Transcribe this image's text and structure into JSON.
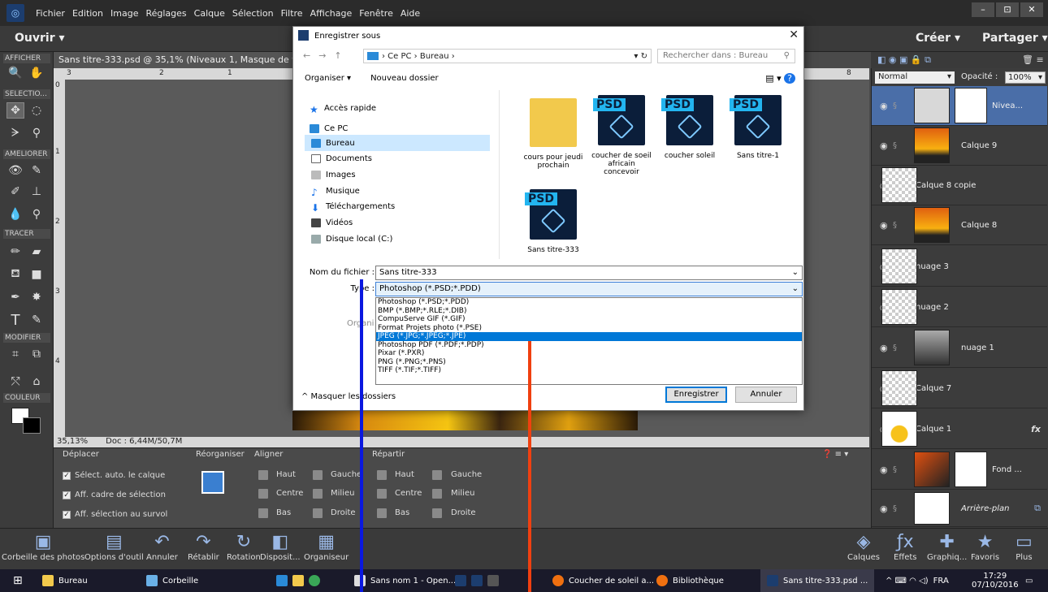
{
  "menu": {
    "items": [
      "Fichier",
      "Edition",
      "Image",
      "Réglages",
      "Calque",
      "Sélection",
      "Filtre",
      "Affichage",
      "Fenêtre",
      "Aide"
    ]
  },
  "window_controls": [
    "–",
    "⊡",
    "✕"
  ],
  "topbar": {
    "open": "Ouvrir ▾",
    "create": "Créer ▾",
    "share": "Partager ▾"
  },
  "tools": {
    "sections": [
      "AFFICHER",
      "SELECTIO...",
      "AMELIORER",
      "TRACER",
      "MODIFIER",
      "COULEUR"
    ]
  },
  "document": {
    "tab_title": "Sans titre-333.psd @ 35,1% (Niveaux 1, Masque de fusion/8) *",
    "ruler_top": [
      "3",
      "2",
      "1",
      "8"
    ],
    "ruler_left": [
      "0",
      "1",
      "2",
      "3",
      "4"
    ],
    "zoom": "35,13%",
    "doc_info": "Doc : 6,44M/50,7M"
  },
  "options": {
    "move_label": "Déplacer",
    "reorganize_label": "Réorganiser",
    "align_label": "Aligner",
    "distribute_label": "Répartir",
    "checks": [
      "Sélect. auto. le calque",
      "Aff. cadre de sélection",
      "Aff. sélection au survol"
    ],
    "align": {
      "haut": "Haut",
      "centre": "Centre",
      "bas": "Bas",
      "gauche": "Gauche",
      "milieu": "Milieu",
      "droite": "Droite"
    },
    "distribute": {
      "haut": "Haut",
      "centre": "Centre",
      "bas": "Bas",
      "gauche": "Gauche",
      "milieu": "Milieu",
      "droite": "Droite"
    }
  },
  "bottombar": {
    "left": [
      "Corbeille des photos",
      "Options d'outil",
      "Annuler",
      "Rétablir",
      "Rotation",
      "Disposit...",
      "Organiseur"
    ],
    "right": [
      "Calques",
      "Effets",
      "Graphiq...",
      "Favoris",
      "Plus"
    ]
  },
  "layers_panel": {
    "blend_mode": "Normal",
    "opacity_label": "Opacité :",
    "opacity_value": "100%",
    "layers": [
      {
        "name": "Nivea...",
        "active": true
      },
      {
        "name": "Calque 9"
      },
      {
        "name": "Calque 8 copie"
      },
      {
        "name": "Calque 8"
      },
      {
        "name": "nuage 3"
      },
      {
        "name": "nuage 2"
      },
      {
        "name": "nuage 1"
      },
      {
        "name": "Calque 7"
      },
      {
        "name": "Calque 1",
        "fx": "fx"
      },
      {
        "name": "Fond ..."
      },
      {
        "name": "Arrière-plan"
      }
    ]
  },
  "dialog": {
    "title": "Enregistrer sous",
    "address": "› Ce PC  ›  Bureau  ›",
    "search_placeholder": "Rechercher dans : Bureau",
    "organize": "Organiser ▾",
    "new_folder": "Nouveau dossier",
    "nav": [
      "Accès rapide",
      "Ce PC",
      "Bureau",
      "Documents",
      "Images",
      "Musique",
      "Téléchargements",
      "Vidéos",
      "Disque local (C:)"
    ],
    "files": [
      {
        "name": "cours pour jeudi prochain",
        "kind": "folder"
      },
      {
        "name": "coucher de soeil africain concevoir",
        "kind": "psd"
      },
      {
        "name": "coucher soleil",
        "kind": "psd"
      },
      {
        "name": "Sans titre-1",
        "kind": "psd"
      },
      {
        "name": "Sans titre-333",
        "kind": "psd"
      }
    ],
    "psd_tag": "PSD",
    "filename_label": "Nom du fichier :",
    "filename_value": "Sans titre-333",
    "type_label": "Type :",
    "type_value": "Photoshop (*.PSD;*.PDD)",
    "type_options": [
      "Photoshop (*.PSD;*.PDD)",
      "BMP (*.BMP;*.RLE;*.DIB)",
      "CompuServe GIF (*.GIF)",
      "Format Projets photo (*.PSE)",
      "JPEG (*.JPG;*.JPEG;*.JPE)",
      "Photoshop PDF (*.PDF;*.PDP)",
      "Pixar (*.PXR)",
      "PNG (*.PNG;*.PNS)",
      "TIFF (*.TIF;*.TIFF)"
    ],
    "type_highlighted_index": 4,
    "organize_partial": "Organi",
    "hide_folders": "^ Masquer les dossiers",
    "save": "Enregistrer",
    "cancel": "Annuler"
  },
  "taskbar": {
    "items": [
      "Bureau",
      "Corbeille",
      "Sans nom 1 - Open...",
      "Coucher de soleil a...",
      "Bibliothèque",
      "Sans titre-333.psd ..."
    ],
    "tray": "FRA",
    "time": "17:29",
    "date": "07/10/2016"
  },
  "colors": {
    "accent": "#0078d7",
    "annotation_blue": "#0a18e0",
    "annotation_orange": "#f04010",
    "active_layer": "#4a6ea8"
  }
}
